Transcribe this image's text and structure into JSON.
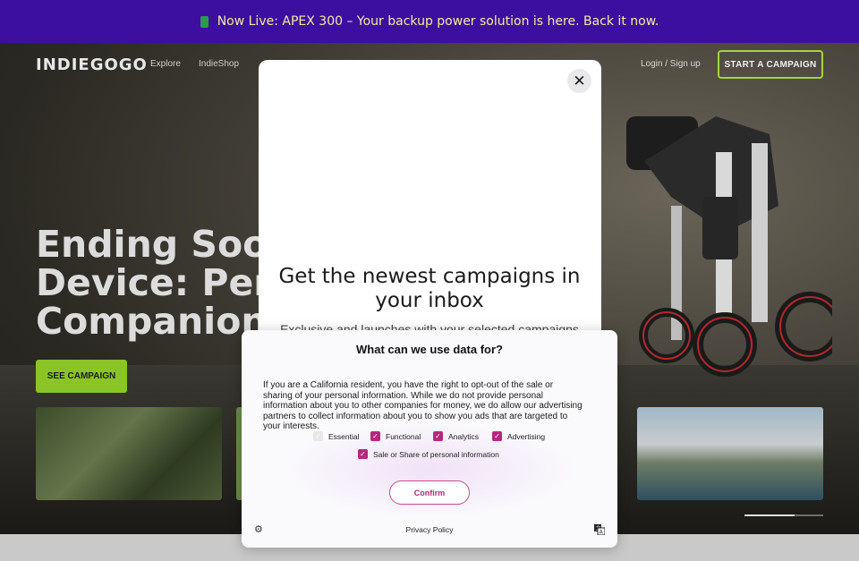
{
  "announcement": {
    "text": "Now Live: APEX 300 – Your backup power solution is here. Back it now."
  },
  "header": {
    "logo": "INDIEGOGO",
    "nav": [
      "Explore",
      "IndieShop"
    ],
    "login": "Login / Sign up",
    "start_campaign": "START A CAMPAIGN"
  },
  "hero": {
    "title_lines": [
      "Ending Soon! I",
      "Device: Perfec",
      "Companion"
    ],
    "cta": "SEE CAMPAIGN"
  },
  "newsletter_modal": {
    "title": "Get the newest campaigns in your inbox",
    "subtitle": "Exclusive and launches with your selected campaigns"
  },
  "consent": {
    "title": "What can we use data for?",
    "body": "If you are a California resident, you have the right to opt-out of the sale or sharing of your personal information. While we do not provide personal information about you to other companies for money, we do allow our advertising partners to collect information about you to show you ads that are targeted to your interests.",
    "options": [
      {
        "label": "Essential",
        "checked": true,
        "disabled": true
      },
      {
        "label": "Functional",
        "checked": true,
        "disabled": false
      },
      {
        "label": "Analytics",
        "checked": true,
        "disabled": false
      },
      {
        "label": "Advertising",
        "checked": true,
        "disabled": false
      },
      {
        "label": "Sale or Share of personal information",
        "checked": true,
        "disabled": false
      }
    ],
    "confirm": "Confirm",
    "privacy": "Privacy Policy"
  },
  "colors": {
    "announcement_bg": "#3d0fa0",
    "accent_green": "#8ac425",
    "consent_accent": "#b8277d"
  }
}
